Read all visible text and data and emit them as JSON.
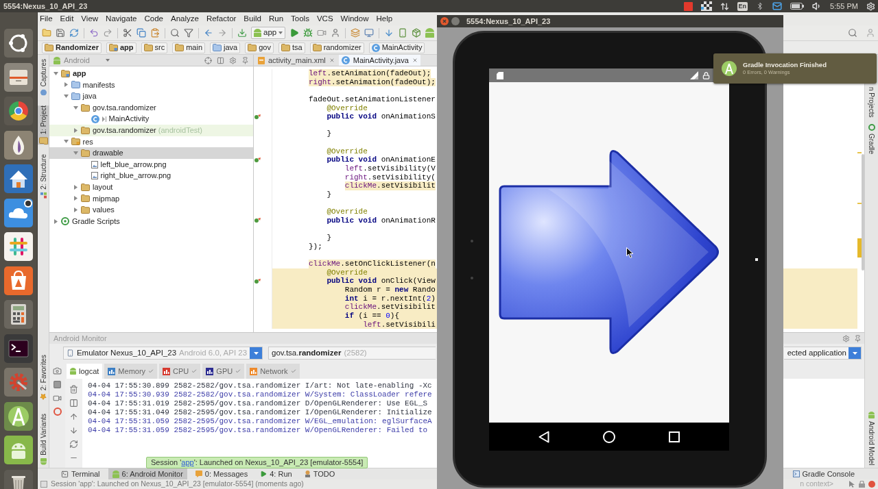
{
  "top_panel": {
    "title": "5554:Nexus_10_API_23",
    "keyboard_layout": "En",
    "clock": "5:55 PM"
  },
  "ide": {
    "menu": [
      "File",
      "Edit",
      "View",
      "Navigate",
      "Code",
      "Analyze",
      "Refactor",
      "Build",
      "Run",
      "Tools",
      "VCS",
      "Window",
      "Help"
    ],
    "run_configuration": "app",
    "breadcrumbs": [
      {
        "label": "Randomizer",
        "kind": "project"
      },
      {
        "label": "app",
        "kind": "module"
      },
      {
        "label": "src",
        "kind": "folder"
      },
      {
        "label": "main",
        "kind": "folder"
      },
      {
        "label": "java",
        "kind": "source"
      },
      {
        "label": "gov",
        "kind": "folder"
      },
      {
        "label": "tsa",
        "kind": "folder"
      },
      {
        "label": "randomizer",
        "kind": "folder"
      },
      {
        "label": "MainActivity",
        "kind": "class"
      }
    ],
    "left_tool_windows": [
      {
        "label": "Captures",
        "kind": "captures",
        "selected": false
      },
      {
        "label": "1: Project",
        "kind": "project",
        "selected": true
      },
      {
        "label": "2: Structure",
        "kind": "structure",
        "selected": false
      }
    ],
    "left_tool_windows_bottom": [
      {
        "label": "2: Favorites",
        "kind": "favorites",
        "selected": false
      },
      {
        "label": "Build Variants",
        "kind": "android",
        "selected": false
      }
    ],
    "right_tool_windows": [
      {
        "label": "n Projects",
        "kind": "plain",
        "selected": false
      },
      {
        "label": "Gradle",
        "kind": "gradle",
        "selected": false
      },
      {
        "label": "Android Model",
        "kind": "android",
        "selected": false
      }
    ],
    "project_view": {
      "mode": "Android",
      "tree": [
        {
          "label": "app",
          "kind": "module",
          "expanded": true,
          "selected": false,
          "children": [
            {
              "label": "manifests",
              "kind": "source",
              "expanded": false,
              "selected": false
            },
            {
              "label": "java",
              "kind": "source",
              "expanded": true,
              "selected": false,
              "children": [
                {
                  "label": "gov.tsa.randomizer",
                  "kind": "package",
                  "expanded": true,
                  "selected": false,
                  "children": [
                    {
                      "label": "MainActivity",
                      "kind": "class",
                      "selected": false
                    }
                  ]
                },
                {
                  "label": "gov.tsa.randomizer",
                  "note": "(androidTest)",
                  "kind": "test_package",
                  "expanded": false,
                  "selected": false
                }
              ]
            },
            {
              "label": "res",
              "kind": "res",
              "expanded": true,
              "selected": false,
              "children": [
                {
                  "label": "drawable",
                  "kind": "package",
                  "expanded": true,
                  "selected": true,
                  "children": [
                    {
                      "label": "left_blue_arrow.png",
                      "kind": "image",
                      "selected": false
                    },
                    {
                      "label": "right_blue_arrow.png",
                      "kind": "image",
                      "selected": false
                    }
                  ]
                },
                {
                  "label": "layout",
                  "kind": "package",
                  "expanded": false,
                  "selected": false
                },
                {
                  "label": "mipmap",
                  "kind": "package",
                  "expanded": false,
                  "selected": false
                },
                {
                  "label": "values",
                  "kind": "package",
                  "expanded": false,
                  "selected": false
                }
              ]
            }
          ]
        },
        {
          "label": "Gradle Scripts",
          "kind": "gradle",
          "expanded": false,
          "selected": false
        }
      ]
    },
    "editor": {
      "tabs": [
        {
          "label": "activity_main.xml",
          "kind": "xml",
          "selected": false
        },
        {
          "label": "MainActivity.java",
          "kind": "java",
          "selected": true
        }
      ],
      "lines": [
        {
          "kind": "code",
          "text_highlight": true,
          "line_highlight": false,
          "override": false,
          "segments": [
            {
              "text": "left",
              "kind": "field"
            },
            {
              "text": ".setAnimation(fadeOut);",
              "kind": "plain"
            }
          ]
        },
        {
          "kind": "code",
          "text_highlight": true,
          "line_highlight": false,
          "override": false,
          "segments": [
            {
              "text": "right",
              "kind": "field"
            },
            {
              "text": ".setAnimation(fadeOut);",
              "kind": "plain"
            }
          ]
        },
        {
          "kind": "blank"
        },
        {
          "kind": "code",
          "text_highlight": false,
          "line_highlight": false,
          "override": false,
          "segments": [
            {
              "text": "fadeOut.setAnimationListener",
              "kind": "plain"
            }
          ]
        },
        {
          "kind": "code",
          "text_highlight": false,
          "line_highlight": false,
          "override": false,
          "segments": [
            {
              "text": "    @Override",
              "kind": "annotation"
            }
          ]
        },
        {
          "kind": "code",
          "text_highlight": false,
          "line_highlight": false,
          "override": true,
          "segments": [
            {
              "text": "    public void",
              "kind": "keyword"
            },
            {
              "text": " onAnimationS",
              "kind": "plain"
            }
          ]
        },
        {
          "kind": "blank"
        },
        {
          "kind": "code",
          "text_highlight": false,
          "line_highlight": false,
          "override": false,
          "segments": [
            {
              "text": "    }",
              "kind": "plain"
            }
          ]
        },
        {
          "kind": "blank"
        },
        {
          "kind": "code",
          "text_highlight": false,
          "line_highlight": false,
          "override": false,
          "segments": [
            {
              "text": "    @Override",
              "kind": "annotation"
            }
          ]
        },
        {
          "kind": "code",
          "text_highlight": false,
          "line_highlight": false,
          "override": true,
          "segments": [
            {
              "text": "    public void",
              "kind": "keyword"
            },
            {
              "text": " onAnimationE",
              "kind": "plain"
            }
          ]
        },
        {
          "kind": "code",
          "text_highlight": false,
          "line_highlight": false,
          "override": false,
          "segments": [
            {
              "text": "        left",
              "kind": "field"
            },
            {
              "text": ".setVisibility(V",
              "kind": "plain"
            }
          ]
        },
        {
          "kind": "code",
          "text_highlight": false,
          "line_highlight": false,
          "override": false,
          "segments": [
            {
              "text": "        right",
              "kind": "field"
            },
            {
              "text": ".setVisibility(",
              "kind": "plain"
            }
          ]
        },
        {
          "kind": "code",
          "text_highlight": true,
          "line_highlight": false,
          "override": false,
          "segments": [
            {
              "text": "        clickMe",
              "kind": "field"
            },
            {
              "text": ".setVisibilit",
              "kind": "plain"
            }
          ]
        },
        {
          "kind": "code",
          "text_highlight": false,
          "line_highlight": false,
          "override": false,
          "segments": [
            {
              "text": "    }",
              "kind": "plain"
            }
          ]
        },
        {
          "kind": "blank"
        },
        {
          "kind": "code",
          "text_highlight": false,
          "line_highlight": false,
          "override": false,
          "segments": [
            {
              "text": "    @Override",
              "kind": "annotation"
            }
          ]
        },
        {
          "kind": "code",
          "text_highlight": false,
          "line_highlight": false,
          "override": true,
          "segments": [
            {
              "text": "    public void",
              "kind": "keyword"
            },
            {
              "text": " onAnimationR",
              "kind": "plain"
            }
          ]
        },
        {
          "kind": "blank"
        },
        {
          "kind": "code",
          "text_highlight": false,
          "line_highlight": false,
          "override": false,
          "segments": [
            {
              "text": "    }",
              "kind": "plain"
            }
          ]
        },
        {
          "kind": "code",
          "text_highlight": false,
          "line_highlight": false,
          "override": false,
          "segments": [
            {
              "text": "});",
              "kind": "plain"
            }
          ]
        },
        {
          "kind": "blank"
        },
        {
          "kind": "code",
          "text_highlight": true,
          "line_highlight": false,
          "override": false,
          "segments": [
            {
              "text": "clickMe",
              "kind": "field"
            },
            {
              "text": ".setOnClickListener(n",
              "kind": "plain"
            }
          ]
        },
        {
          "kind": "code",
          "text_highlight": false,
          "line_highlight": true,
          "override": false,
          "segments": [
            {
              "text": "    @Override",
              "kind": "annotation"
            }
          ]
        },
        {
          "kind": "code",
          "text_highlight": false,
          "line_highlight": true,
          "override": true,
          "segments": [
            {
              "text": "    public void",
              "kind": "keyword"
            },
            {
              "text": " onClick(View",
              "kind": "plain"
            }
          ]
        },
        {
          "kind": "code",
          "text_highlight": false,
          "line_highlight": true,
          "override": false,
          "segments": [
            {
              "text": "        Random r = ",
              "kind": "plain"
            },
            {
              "text": "new",
              "kind": "keyword"
            },
            {
              "text": " Rando",
              "kind": "plain"
            }
          ]
        },
        {
          "kind": "code",
          "text_highlight": false,
          "line_highlight": true,
          "override": false,
          "segments": [
            {
              "text": "        int",
              "kind": "keyword"
            },
            {
              "text": " i = r.nextInt(",
              "kind": "plain"
            },
            {
              "text": "2",
              "kind": "number"
            },
            {
              "text": ")",
              "kind": "plain"
            }
          ]
        },
        {
          "kind": "code",
          "text_highlight": false,
          "line_highlight": true,
          "override": false,
          "segments": [
            {
              "text": "        clickMe",
              "kind": "field"
            },
            {
              "text": ".setVisibilit",
              "kind": "plain"
            }
          ]
        },
        {
          "kind": "code",
          "text_highlight": false,
          "line_highlight": true,
          "override": false,
          "segments": [
            {
              "text": "        if",
              "kind": "keyword"
            },
            {
              "text": " (i == ",
              "kind": "plain"
            },
            {
              "text": "0",
              "kind": "number"
            },
            {
              "text": "){",
              "kind": "plain"
            }
          ]
        },
        {
          "kind": "code",
          "text_highlight": false,
          "line_highlight": true,
          "override": false,
          "segments": [
            {
              "text": "            left",
              "kind": "field"
            },
            {
              "text": ".setVisibili",
              "kind": "plain"
            }
          ]
        }
      ]
    },
    "android_monitor": {
      "title": "Android Monitor",
      "device": {
        "name": "Emulator Nexus_10_API_23",
        "detail": "Android 6.0, API 23"
      },
      "process": {
        "name": "gov.tsa.**randomizer**",
        "pid": "(2582)"
      },
      "filter": "ected application",
      "tabs": [
        {
          "label": "logcat",
          "kind": "logcat",
          "selected": true
        },
        {
          "label": "Memory",
          "kind": "monitor",
          "color": "#3d7fc4",
          "selected": false
        },
        {
          "label": "CPU",
          "kind": "monitor",
          "color": "#d63a2f",
          "selected": false
        },
        {
          "label": "GPU",
          "kind": "monitor",
          "color": "#2b2b91",
          "selected": false
        },
        {
          "label": "Network",
          "kind": "monitor",
          "color": "#ee8a2c",
          "selected": false
        }
      ],
      "log": [
        {
          "text": "04-04 17:55:30.899 2582-2582/gov.tsa.randomizer I/art: Not late-enabling -Xc",
          "kind": "info"
        },
        {
          "text": "04-04 17:55:30.939 2582-2582/gov.tsa.randomizer W/System: ClassLoader refere",
          "kind": "warn"
        },
        {
          "text": "04-04 17:55:31.019 2582-2595/gov.tsa.randomizer D/OpenGLRenderer: Use EGL_S",
          "kind": "debug"
        },
        {
          "text": "04-04 17:55:31.049 2582-2595/gov.tsa.randomizer I/OpenGLRenderer: Initialize",
          "kind": "info"
        },
        {
          "text": "04-04 17:55:31.059 2582-2595/gov.tsa.randomizer W/EGL_emulation: eglSurfaceA",
          "kind": "warn"
        },
        {
          "text": "04-04 17:55:31.059 2582-2595/gov.tsa.randomizer W/OpenGLRenderer: Failed to",
          "kind": "warn"
        }
      ],
      "balloon": {
        "prefix": "Session '",
        "link": "app",
        "suffix": "': Launched on Nexus_10_API_23 [emulator-5554]"
      }
    },
    "bottom_tabs": [
      {
        "label": "Terminal",
        "kind": "terminal",
        "selected": false
      },
      {
        "label": "6: Android Monitor",
        "kind": "android",
        "selected": true
      },
      {
        "label": "0: Messages",
        "kind": "messages",
        "selected": false
      },
      {
        "label": "4: Run",
        "kind": "run",
        "selected": false
      },
      {
        "label": "TODO",
        "kind": "todo",
        "selected": false
      }
    ],
    "bottom_tabs_right": [
      {
        "label": "Gradle Console",
        "kind": "gradle",
        "selected": false
      }
    ],
    "status_bar": {
      "message": "Session 'app': Launched on Nexus_10_API_23 [emulator-5554] (moments ago)",
      "context": "n context>"
    }
  },
  "emulator": {
    "title": "5554:Nexus_10_API_23"
  },
  "notification": {
    "title": "Gradle Invocation Finished",
    "message": "0 Errors, 0 Warnings"
  }
}
